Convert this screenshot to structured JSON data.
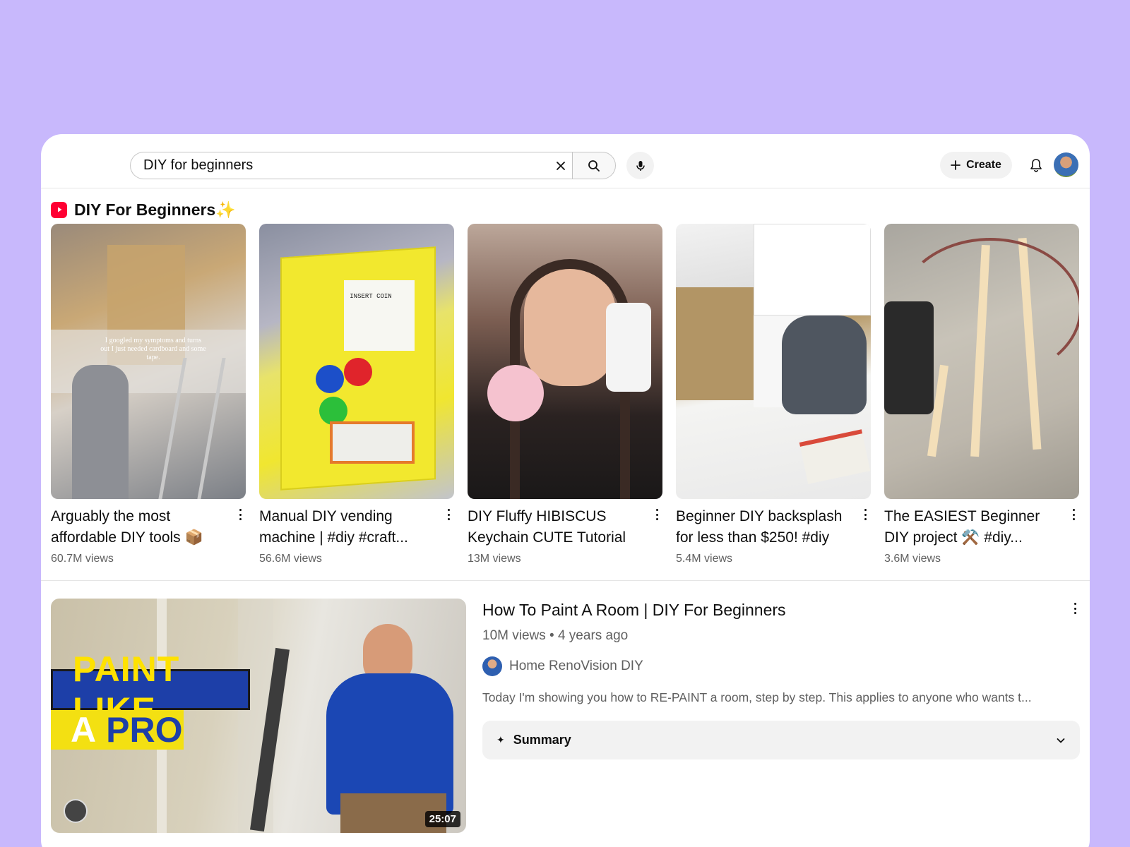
{
  "search": {
    "query": "DIY for beginners"
  },
  "header": {
    "create_label": "Create"
  },
  "shorts_section": {
    "title": "DIY For Beginners✨",
    "items": [
      {
        "title": "Arguably the most affordable DIY tools 📦",
        "views": "60.7M views",
        "overlay_text": "I googled my symptoms and turns out I just needed cardboard and some tape."
      },
      {
        "title": "Manual DIY vending machine | #diy #craft...",
        "views": "56.6M views",
        "overlay_text": "INSERT COIN"
      },
      {
        "title": "DIY Fluffy HIBISCUS Keychain CUTE Tutorial",
        "views": "13M views"
      },
      {
        "title": "Beginner DIY backsplash for less than $250! #diy",
        "views": "5.4M views"
      },
      {
        "title": "The EASIEST Beginner DIY project ⚒️ #diy...",
        "views": "3.6M views"
      }
    ]
  },
  "video": {
    "title": "How To Paint A Room | DIY For Beginners",
    "meta": "10M views • 4 years ago",
    "channel": "Home RenoVision DIY",
    "description": "Today I'm showing you how to RE-PAINT a room, step by step. This applies to anyone who wants t...",
    "duration": "25:07",
    "thumb_line1": "PAINT LIKE",
    "thumb_line2_a": "A",
    "thumb_line2_b": "PRO",
    "summary_label": "Summary"
  },
  "colors": {
    "background": "#c8b8fc",
    "shorts_brand": "#ff0033",
    "banner_blue": "#1d3fa8",
    "banner_yellow": "#ffe200"
  },
  "icons": [
    "close-icon",
    "search-icon",
    "mic-icon",
    "plus-icon",
    "bell-icon",
    "shorts-icon",
    "more-vert-icon",
    "sparkle-icon",
    "chevron-down-icon"
  ]
}
